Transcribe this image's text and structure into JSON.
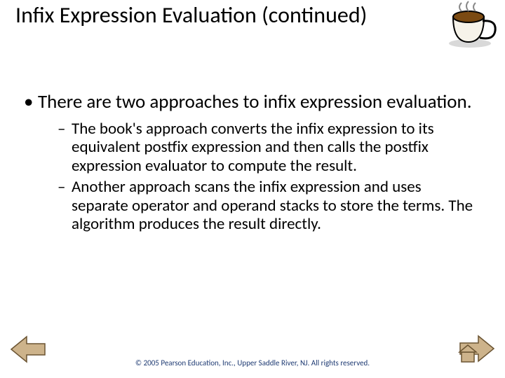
{
  "title": "Infix Expression Evaluation (continued)",
  "bullets": {
    "l1": "There are two approaches to infix expression evaluation.",
    "l2a": "The book's approach converts the infix expression to its equivalent postfix expression and then calls the postfix expression evaluator to compute the result.",
    "l2b": "Another approach scans the infix expression and uses separate operator and operand stacks to store the terms. The algorithm produces the result directly."
  },
  "copyright": "© 2005 Pearson Education, Inc., Upper Saddle River, NJ.  All rights reserved.",
  "icons": {
    "coffee": "coffee-cup-icon",
    "prev": "prev-arrow-icon",
    "next": "home-next-icon"
  }
}
